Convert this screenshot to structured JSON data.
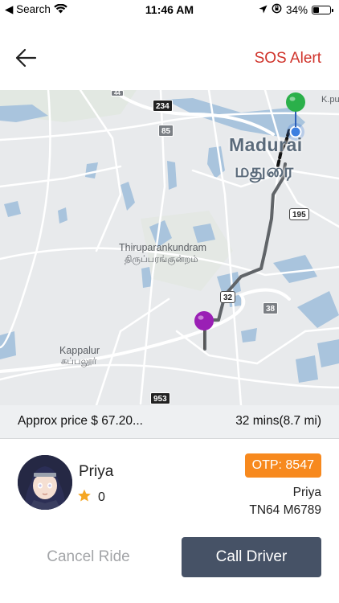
{
  "status_bar": {
    "back_label": "◀ Search",
    "time": "11:46 AM",
    "battery": "34%",
    "battery_level": 0.34,
    "icons": [
      "wifi-icon",
      "location-arrow-icon",
      "orientation-lock-icon",
      "battery-icon"
    ]
  },
  "header": {
    "back_icon": "arrow-left-icon",
    "sos_label": "SOS Alert"
  },
  "map": {
    "city_name": "Madurai",
    "city_name_tamil": "மதுரை",
    "places": [
      {
        "name": "Thiruparankundram",
        "name_tamil": "திருப்பரங்குன்றம்"
      },
      {
        "name": "Kappalur",
        "name_tamil": "கப்பலூர்"
      }
    ],
    "partial_label": "K.pu",
    "route_shields": [
      "234",
      "85",
      "195",
      "32",
      "38",
      "953",
      "44"
    ],
    "pins": [
      {
        "role": "pickup",
        "color": "#2bb04a"
      },
      {
        "role": "drop",
        "color": "#9a1fb5"
      }
    ],
    "route_color": "#606468"
  },
  "trip": {
    "price": "Approx price $ 67.20...",
    "eta": "32 mins(8.7 mi)"
  },
  "driver": {
    "name": "Priya",
    "rating": "0",
    "otp": "OTP: 8547",
    "vehicle_owner": "Priya",
    "plate": "TN64 M6789",
    "otp_color": "#f7891e"
  },
  "actions": {
    "cancel_label": "Cancel Ride",
    "call_label": "Call Driver"
  }
}
